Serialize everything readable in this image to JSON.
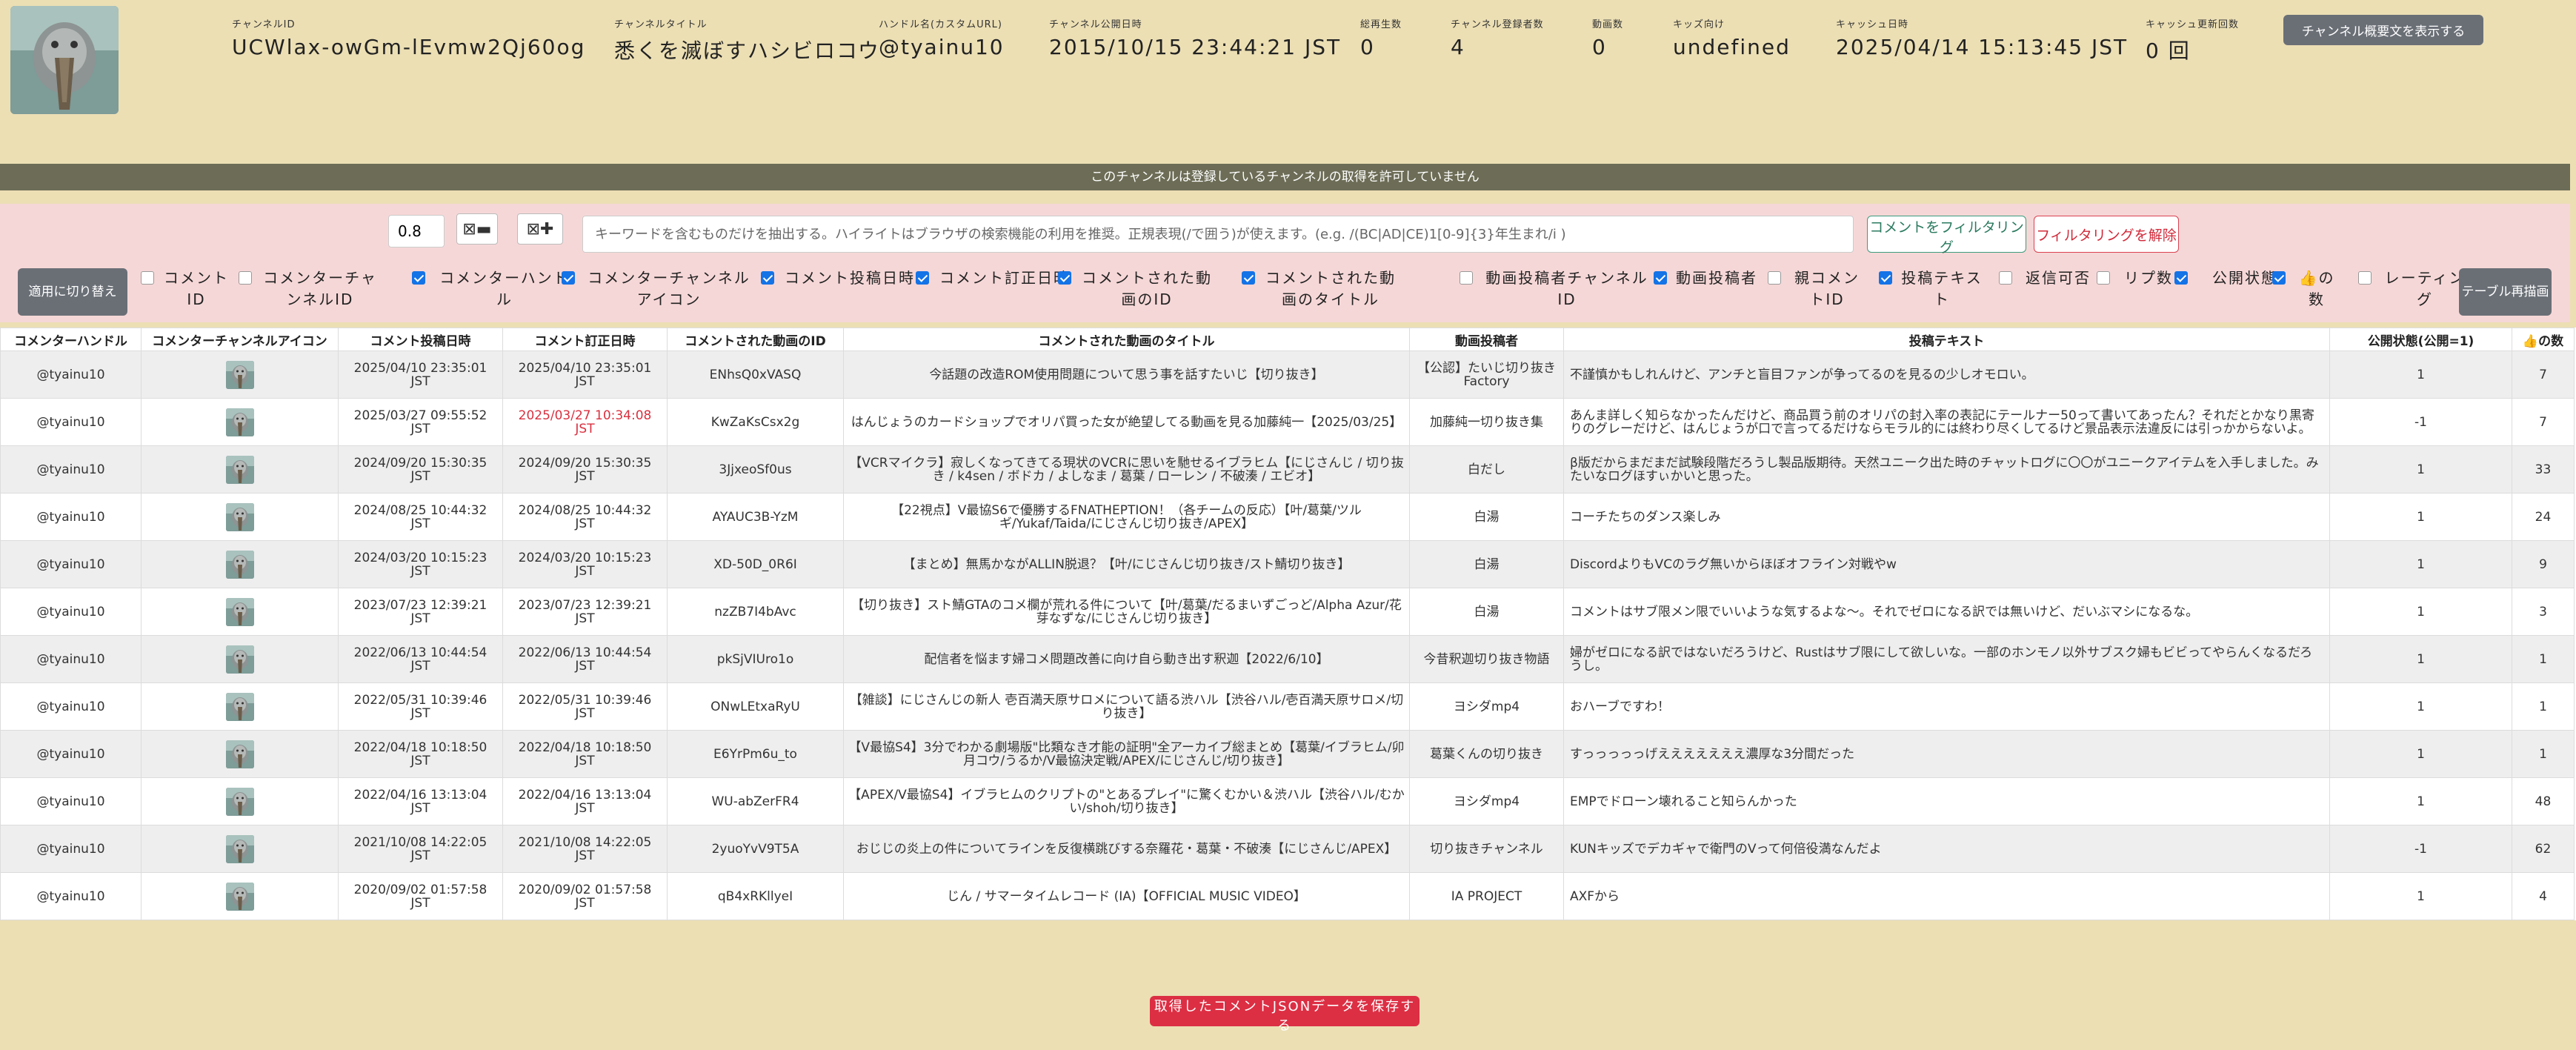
{
  "header": {
    "channel_id_label": "チャンネルID",
    "channel_id": "UCWlax-owGm-lEvmw2Qj60og",
    "channel_title_label": "チャンネルタイトル",
    "channel_title": "悉くを滅ぼすハシビロコウ",
    "handle_label": "ハンドル名(カスタムURL)",
    "handle": "@tyainu10",
    "published_label": "チャンネル公開日時",
    "published": "2015/10/15 23:44:21 JST",
    "total_videos_label": "総再生数",
    "total_videos": "0",
    "subscribers_label": "チャンネル登録者数",
    "subscribers": "4",
    "videos_label": "動画数",
    "videos": "0",
    "kids_label": "キッズ向け",
    "kids": "undefined",
    "cache_label": "キャッシュ日時",
    "cache": "2025/04/14 15:13:45 JST",
    "cache_updates_label": "キャッシュ更新回数",
    "cache_updates": "0 回",
    "desc_button": "チャンネル概要文を表示する"
  },
  "notice": "このチャンネルは登録しているチャンネルの取得を許可していません",
  "filter": {
    "threshold": "0.8",
    "zoom_out_label": "⊠▬",
    "zoom_in_label": "⊠✚",
    "keyword_placeholder": "キーワードを含むものだけを抽出する。ハイライトはブラウザの検索機能の利用を推奨。正規表現(/で囲う)が使えます。(e.g. /(BC|AD|CE)1[0-9]{3}年生まれ/i )",
    "filter_button": "コメントをフィルタリング",
    "unfilter_button": "フィルタリングを解除",
    "switch_button": "適用に切り替え",
    "redraw_button": "テーブル再描画",
    "columns": [
      {
        "label": "コメントID",
        "checked": false
      },
      {
        "label": "コメンターチャンネルID",
        "checked": false
      },
      {
        "label": "コメンターハンドル",
        "checked": true
      },
      {
        "label": "コメンターチャンネルアイコン",
        "checked": true
      },
      {
        "label": "コメント投稿日時",
        "checked": true
      },
      {
        "label": "コメント訂正日時",
        "checked": true
      },
      {
        "label": "コメントされた動画のID",
        "checked": true
      },
      {
        "label": "コメントされた動画のタイトル",
        "checked": true
      },
      {
        "label": "動画投稿者チャンネルID",
        "checked": false
      },
      {
        "label": "動画投稿者",
        "checked": true
      },
      {
        "label": "親コメントID",
        "checked": false
      },
      {
        "label": "投稿テキスト",
        "checked": true
      },
      {
        "label": "返信可否",
        "checked": false
      },
      {
        "label": "リプ数",
        "checked": false
      },
      {
        "label": "公開状態",
        "checked": true
      },
      {
        "label": "👍の数",
        "checked": true
      },
      {
        "label": "レーティング",
        "checked": false
      }
    ]
  },
  "table": {
    "headers": [
      "コメンターハンドル",
      "コメンターチャンネルアイコン",
      "コメント投稿日時",
      "コメント訂正日時",
      "コメントされた動画のID",
      "コメントされた動画のタイトル",
      "動画投稿者",
      "投稿テキスト",
      "公開状態(公開=1)",
      "👍の数"
    ],
    "rows": [
      {
        "handle": "@tyainu10",
        "posted": "2025/04/10 23:35:01 JST",
        "edited": "2025/04/10 23:35:01 JST",
        "edited_changed": false,
        "video_id": "ENhsQ0xVASQ",
        "title": "今話題の改造ROM使用問題について思う事を話すたいじ【切り抜き】",
        "uploader": "【公認】たいじ切り抜きFactory",
        "text": "不謹慎かもしれんけど、アンチと盲目ファンが争ってるのを見るの少しオモロい。",
        "public": "1",
        "likes": "7"
      },
      {
        "handle": "@tyainu10",
        "posted": "2025/03/27 09:55:52 JST",
        "edited": "2025/03/27 10:34:08 JST",
        "edited_changed": true,
        "video_id": "KwZaKsCsx2g",
        "title": "はんじょうのカードショップでオリパ買った女が絶望してる動画を見る加藤純一【2025/03/25】",
        "uploader": "加藤純一切り抜き集",
        "text": "あんま詳しく知らなかったんだけど、商品買う前のオリパの封入率の表記にテールナー50って書いてあったん？それだとかなり黒寄りのグレーだけど、はんじょうが口で言ってるだけならモラル的には終わり尽くしてるけど景品表示法違反には引っかからないよ。",
        "public": "-1",
        "likes": "7"
      },
      {
        "handle": "@tyainu10",
        "posted": "2024/09/20 15:30:35 JST",
        "edited": "2024/09/20 15:30:35 JST",
        "edited_changed": false,
        "video_id": "3JjxeoSf0us",
        "title": "【VCRマイクラ】寂しくなってきてる現状のVCRに思いを馳せるイブラヒム【にじさんじ / 切り抜き / k4sen / ボドカ / よしなま / 葛葉 / ローレン / 不破湊 / エビオ】",
        "uploader": "白だし",
        "text": "β版だからまだまだ試験段階だろうし製品版期待。天然ユニーク出た時のチャットログに〇〇がユニークアイテムを入手しました。みたいなログほすぃかいと思った。",
        "public": "1",
        "likes": "33"
      },
      {
        "handle": "@tyainu10",
        "posted": "2024/08/25 10:44:32 JST",
        "edited": "2024/08/25 10:44:32 JST",
        "edited_changed": false,
        "video_id": "AYAUC3B-YzM",
        "title": "【22視点】V最協S6で優勝するFNATHEPTION！（各チームの反応）【叶/葛葉/ツルギ/Yukaf/Taida/にじさんじ切り抜き/APEX】",
        "uploader": "白湯",
        "text": "コーチたちのダンス楽しみ",
        "public": "1",
        "likes": "24"
      },
      {
        "handle": "@tyainu10",
        "posted": "2024/03/20 10:15:23 JST",
        "edited": "2024/03/20 10:15:23 JST",
        "edited_changed": false,
        "video_id": "XD-50D_0R6I",
        "title": "【まとめ】無馬かながALLIN脱退？【叶/にじさんじ切り抜き/スト鯖切り抜き】",
        "uploader": "白湯",
        "text": "DiscordよりもVCのラグ無いからほぼオフライン対戦やw",
        "public": "1",
        "likes": "9"
      },
      {
        "handle": "@tyainu10",
        "posted": "2023/07/23 12:39:21 JST",
        "edited": "2023/07/23 12:39:21 JST",
        "edited_changed": false,
        "video_id": "nzZB7I4bAvc",
        "title": "【切り抜き】スト鯖GTAのコメ欄が荒れる件について【叶/葛葉/だるまいずごっど/Alpha Azur/花芽なずな/にじさんじ切り抜き】",
        "uploader": "白湯",
        "text": "コメントはサブ限メン限でいいような気するよな～。それでゼロになる訳では無いけど、だいぶマシになるな。",
        "public": "1",
        "likes": "3"
      },
      {
        "handle": "@tyainu10",
        "posted": "2022/06/13 10:44:54 JST",
        "edited": "2022/06/13 10:44:54 JST",
        "edited_changed": false,
        "video_id": "pkSjVIUro1o",
        "title": "配信者を悩ます婦コメ問題改善に向け自ら動き出す釈迦【2022/6/10】",
        "uploader": "今昔釈迦切り抜き物語",
        "text": "婦がゼロになる訳ではないだろうけど、Rustはサブ限にして欲しいな。一部のホンモノ以外サブスク婦もビビってやらんくなるだろうし。",
        "public": "1",
        "likes": "1"
      },
      {
        "handle": "@tyainu10",
        "posted": "2022/05/31 10:39:46 JST",
        "edited": "2022/05/31 10:39:46 JST",
        "edited_changed": false,
        "video_id": "ONwLEtxaRyU",
        "title": "【雑談】にじさんじの新人 壱百満天原サロメについて語る渋ハル【渋谷ハル/壱百満天原サロメ/切り抜き】",
        "uploader": "ヨシダmp4",
        "text": "おハーブですわ！",
        "public": "1",
        "likes": "1"
      },
      {
        "handle": "@tyainu10",
        "posted": "2022/04/18 10:18:50 JST",
        "edited": "2022/04/18 10:18:50 JST",
        "edited_changed": false,
        "video_id": "E6YrPm6u_to",
        "title": "【V最協S4】3分でわかる劇場版\"比類なき才能の証明\"全アーカイブ総まとめ【葛葉/イブラヒム/卯月コウ/うるか/V最協決定戦/APEX/にじさんじ/切り抜き】",
        "uploader": "葛葉くんの切り抜き",
        "text": "すっっっっっげえええええええ濃厚な3分間だった",
        "public": "1",
        "likes": "1"
      },
      {
        "handle": "@tyainu10",
        "posted": "2022/04/16 13:13:04 JST",
        "edited": "2022/04/16 13:13:04 JST",
        "edited_changed": false,
        "video_id": "WU-abZerFR4",
        "title": "【APEX/V最協S4】イブラヒムのクリプトの\"とあるプレイ\"に驚くむかい＆渋ハル【渋谷ハル/むかい/shoh/切り抜き】",
        "uploader": "ヨシダmp4",
        "text": "EMPでドローン壊れること知らんかった",
        "public": "1",
        "likes": "48"
      },
      {
        "handle": "@tyainu10",
        "posted": "2021/10/08 14:22:05 JST",
        "edited": "2021/10/08 14:22:05 JST",
        "edited_changed": false,
        "video_id": "2yuoYvV9T5A",
        "title": "おじじの炎上の件についてラインを反復横跳びする奈羅花・葛葉・不破湊【にじさんじ/APEX】",
        "uploader": "切り抜きチャンネル",
        "text": "KUNキッズでデカギャで衛門のVって何倍役満なんだよ",
        "public": "-1",
        "likes": "62"
      },
      {
        "handle": "@tyainu10",
        "posted": "2020/09/02 01:57:58 JST",
        "edited": "2020/09/02 01:57:58 JST",
        "edited_changed": false,
        "video_id": "qB4xRKllyeI",
        "title": "じん / サマータイムレコード (IA)【OFFICIAL MUSIC VIDEO】",
        "uploader": "IA PROJECT",
        "text": "AXFから",
        "public": "1",
        "likes": "4"
      }
    ]
  },
  "save_button": "取得したコメントJSONデータを保存する",
  "colors": {
    "background": "#ecdfb4",
    "notice": "#6d6d57",
    "filter_bar": "#f6d7d7",
    "checkbox_on": "#1473e6",
    "save_button": "#dc2f44",
    "edited_red": "#d9303f"
  }
}
